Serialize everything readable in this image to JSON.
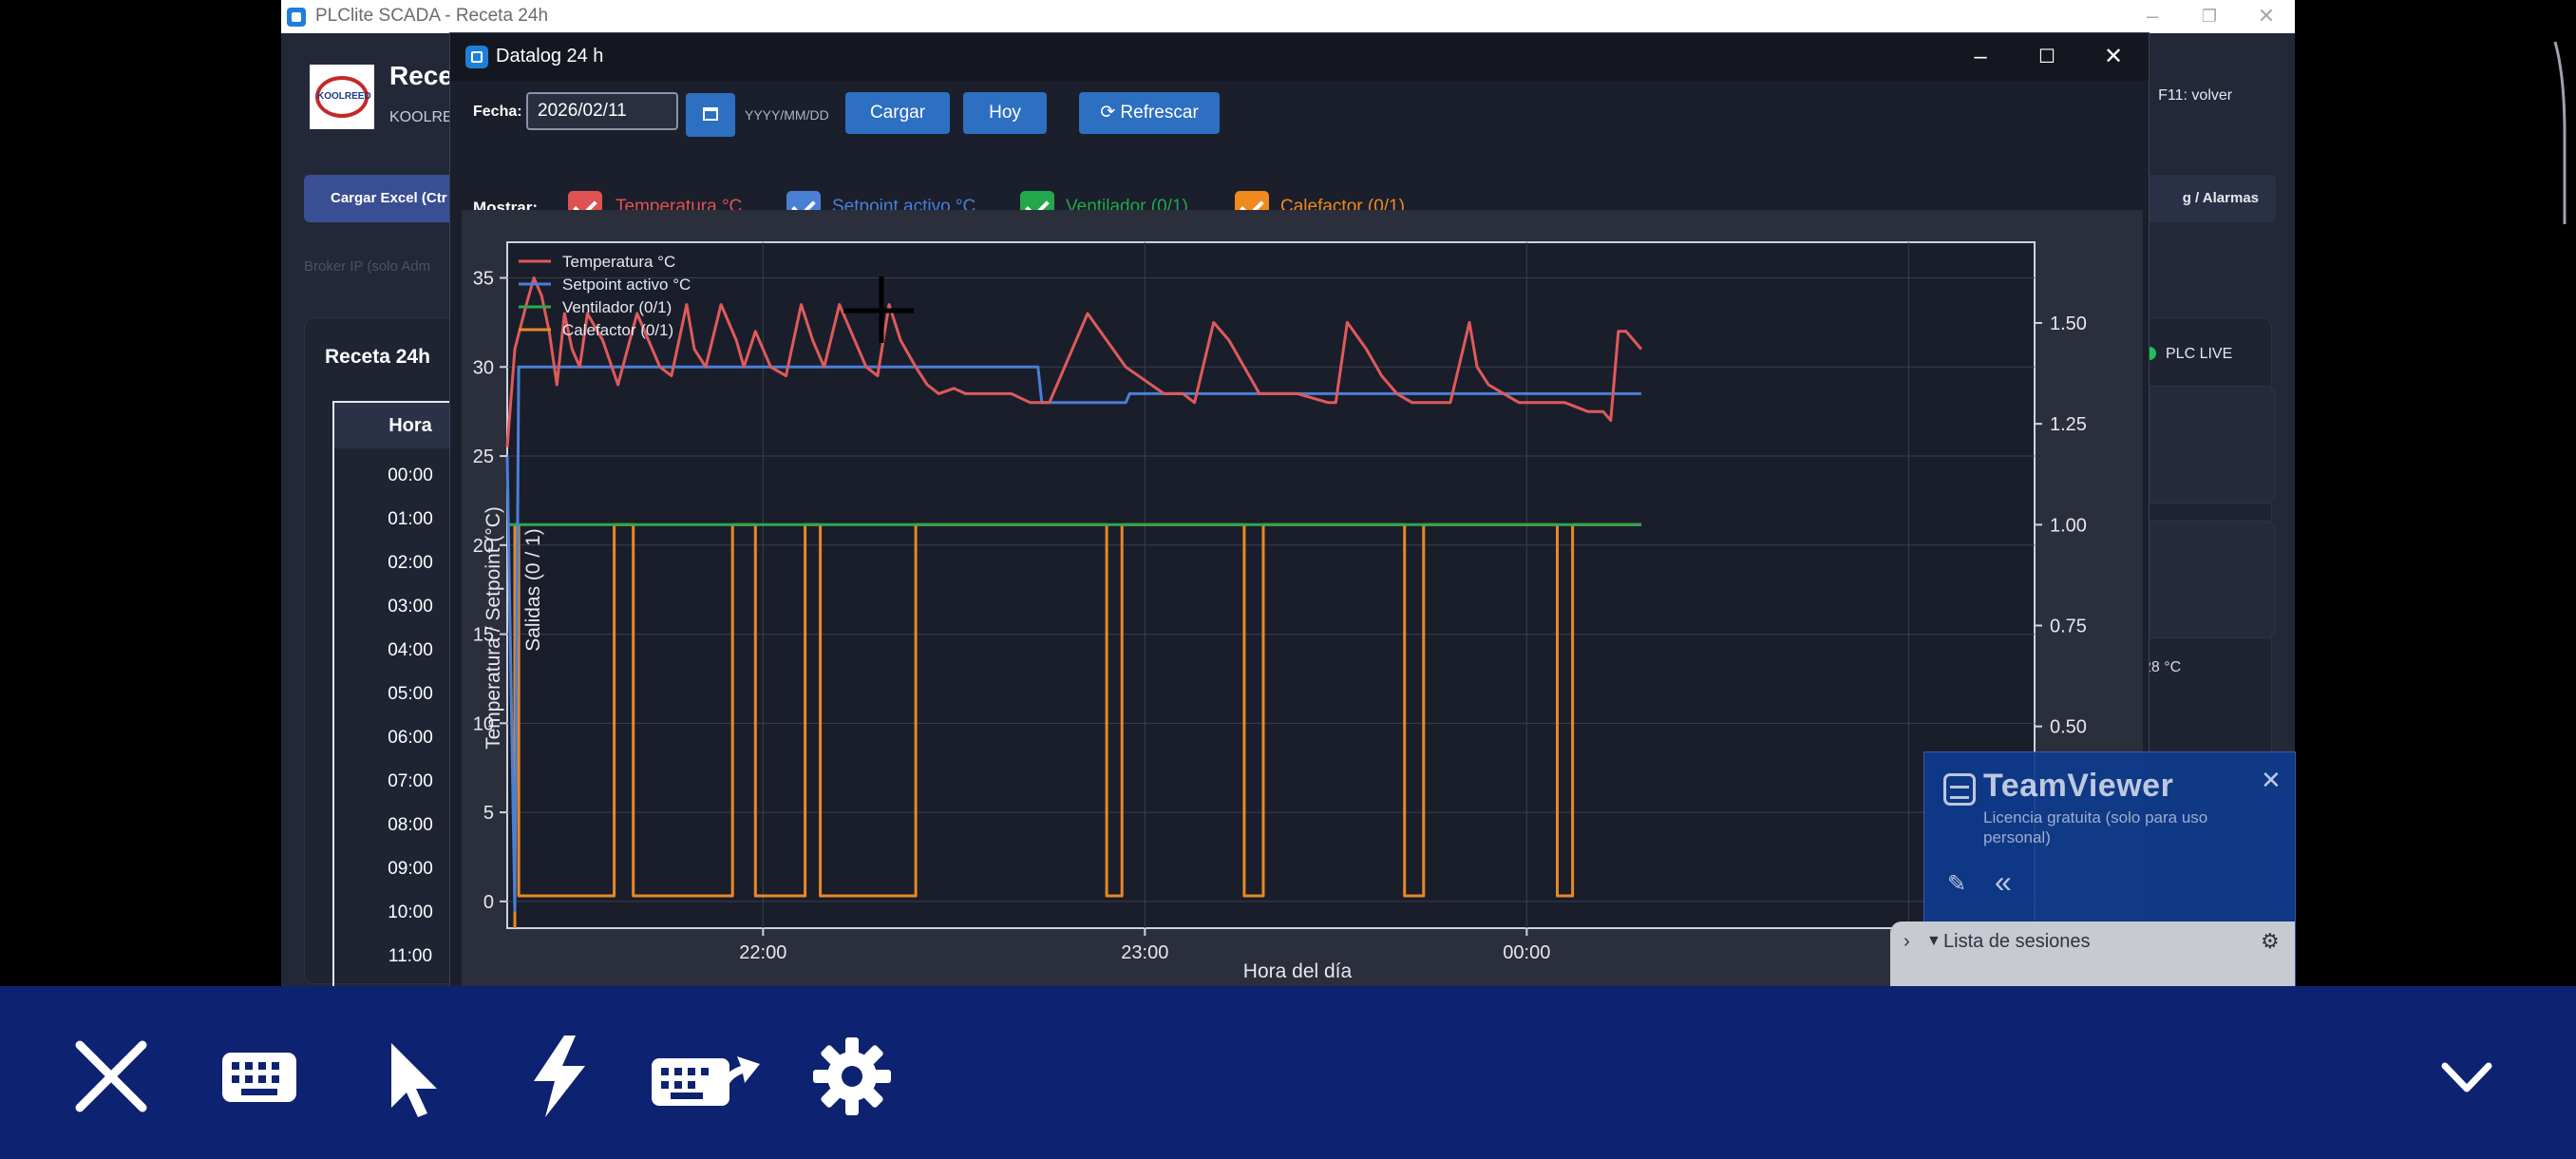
{
  "main_window": {
    "title": "PLClite SCADA - Receta 24h",
    "heading": "Rece",
    "subtitle": "KOOLRE",
    "logo_text": "KOOLREED",
    "f11_hint": "F11: volver",
    "excel_button": "Cargar Excel (Ctr",
    "datalog_button": "g / Alarmas",
    "broker_label": "Broker IP (solo Adm",
    "recipe_title": "Receta 24h",
    "plc_live": "PLC LIVE",
    "temp_readout": "28 °C",
    "table_header": "Hora",
    "hours": [
      "00:00",
      "01:00",
      "02:00",
      "03:00",
      "04:00",
      "05:00",
      "06:00",
      "07:00",
      "08:00",
      "09:00",
      "10:00",
      "11:00"
    ]
  },
  "dialog": {
    "title": "Datalog 24 h",
    "fecha_label": "Fecha:",
    "date_value": "2026/02/11",
    "date_format": "YYYY/MM/DD",
    "load_button": "Cargar",
    "today_button": "Hoy",
    "refresh_button": "⟳ Refrescar",
    "show_label": "Mostrar:",
    "checkboxes": [
      {
        "label": "Temperatura °C",
        "checked": true,
        "color": "#e05252"
      },
      {
        "label": "Setpoint activo °C",
        "checked": true,
        "color": "#4a7fd6"
      },
      {
        "label": "Ventilador (0/1)",
        "checked": true,
        "color": "#22a84a"
      },
      {
        "label": "Calefactor (0/1)",
        "checked": true,
        "color": "#f08a1e"
      }
    ]
  },
  "chart_data": {
    "type": "line",
    "xlabel": "Hora del día",
    "ylabel": "Temperatura / Setpoint (°C)",
    "y2label": "Salidas (0 / 1)",
    "x_ticks": [
      "22:00",
      "23:00",
      "00:00"
    ],
    "x_tick_hours": [
      22,
      23,
      24
    ],
    "xlim_hours": [
      21.33,
      25.33
    ],
    "ylim": [
      -1.5,
      37
    ],
    "y_ticks": [
      0,
      5,
      10,
      15,
      20,
      25,
      30,
      35
    ],
    "y2lim": [
      0,
      1.7
    ],
    "y2_ticks": [
      0.5,
      0.75,
      1.0,
      1.25,
      1.5
    ],
    "y2_tick_labels": [
      "0.50",
      "0.75",
      "1.00",
      "1.25",
      "1.50"
    ],
    "grid": true,
    "legend_position": "top-left",
    "series": [
      {
        "name": "Temperatura °C",
        "axis": "left",
        "color": "#e05a5a",
        "x": [
          21.33,
          21.35,
          21.38,
          21.4,
          21.42,
          21.44,
          21.46,
          21.48,
          21.5,
          21.52,
          21.54,
          21.58,
          21.62,
          21.67,
          21.7,
          21.73,
          21.76,
          21.8,
          21.82,
          21.85,
          21.89,
          21.93,
          21.95,
          21.98,
          22.02,
          22.06,
          22.1,
          22.13,
          22.16,
          22.2,
          22.23,
          22.27,
          22.3,
          22.33,
          22.36,
          22.4,
          22.43,
          22.46,
          22.5,
          22.53,
          22.57,
          22.6,
          22.65,
          22.7,
          22.75,
          22.85,
          22.95,
          23.05,
          23.1,
          23.13,
          23.18,
          23.22,
          23.26,
          23.3,
          23.4,
          23.48,
          23.5,
          23.53,
          23.58,
          23.62,
          23.66,
          23.7,
          23.8,
          23.85,
          23.87,
          23.9,
          23.94,
          23.98,
          24.02,
          24.06,
          24.1,
          24.16,
          24.2,
          24.22,
          24.24,
          24.26,
          24.28,
          24.3
        ],
        "y": [
          25.5,
          31.0,
          33.5,
          35.0,
          34.0,
          32.0,
          29.0,
          33.0,
          31.0,
          30.0,
          33.0,
          31.5,
          29.0,
          33.0,
          31.5,
          30.0,
          29.5,
          33.5,
          31.0,
          30.0,
          33.5,
          31.5,
          30.0,
          32.0,
          30.0,
          29.5,
          33.5,
          31.5,
          30.0,
          33.5,
          32.0,
          30.0,
          29.5,
          33.5,
          31.5,
          30.0,
          29.0,
          28.5,
          28.8,
          28.5,
          28.5,
          28.5,
          28.5,
          28.0,
          28.0,
          33.0,
          30.0,
          28.5,
          28.5,
          28.0,
          32.5,
          31.5,
          30.0,
          28.5,
          28.5,
          28.0,
          28.0,
          32.5,
          31.0,
          29.5,
          28.5,
          28.0,
          28.0,
          32.5,
          30.0,
          29.0,
          28.5,
          28.0,
          28.0,
          28.0,
          28.0,
          27.5,
          27.5,
          27.0,
          32.0,
          32.0,
          31.5,
          31.0
        ]
      },
      {
        "name": "Setpoint activo °C",
        "axis": "left",
        "color": "#4a7fd6",
        "x": [
          21.33,
          21.35,
          21.36,
          22.72,
          22.73,
          22.95,
          22.96,
          24.3
        ],
        "y": [
          25.0,
          -0.5,
          30.0,
          30.0,
          28.0,
          28.0,
          28.5,
          28.5
        ]
      },
      {
        "name": "Ventilador (0/1)",
        "axis": "right",
        "color": "#2ea84a",
        "x": [
          21.33,
          24.3
        ],
        "y": [
          1.0,
          1.0
        ]
      },
      {
        "name": "Calefactor (0/1)",
        "axis": "right",
        "color": "#e88826",
        "x": [
          21.35,
          21.35,
          21.36,
          21.36,
          21.61,
          21.61,
          21.66,
          21.66,
          21.92,
          21.92,
          21.98,
          21.98,
          22.11,
          22.11,
          22.15,
          22.15,
          22.4,
          22.4,
          22.9,
          22.9,
          22.94,
          22.94,
          23.26,
          23.26,
          23.31,
          23.31,
          23.68,
          23.68,
          23.73,
          23.73,
          24.08,
          24.08,
          24.12,
          24.12,
          24.3
        ],
        "y": [
          0,
          1,
          1,
          0.08,
          0.08,
          1,
          1,
          0.08,
          0.08,
          1,
          1,
          0.08,
          0.08,
          1,
          1,
          0.08,
          0.08,
          1,
          1,
          0.08,
          0.08,
          1,
          1,
          0.08,
          0.08,
          1,
          1,
          0.08,
          0.08,
          1,
          1,
          0.08,
          0.08,
          1,
          1
        ]
      }
    ]
  },
  "teamviewer": {
    "title": "TeamViewer",
    "subtitle": "Licencia gratuita (solo para uso personal)",
    "sessions": "Lista de sesiones"
  },
  "toolbar": {
    "icons": [
      "close-icon",
      "keyboard-icon",
      "pointer-icon",
      "lightning-icon",
      "special-keys-icon",
      "settings-icon",
      "chevron-down-icon"
    ]
  }
}
